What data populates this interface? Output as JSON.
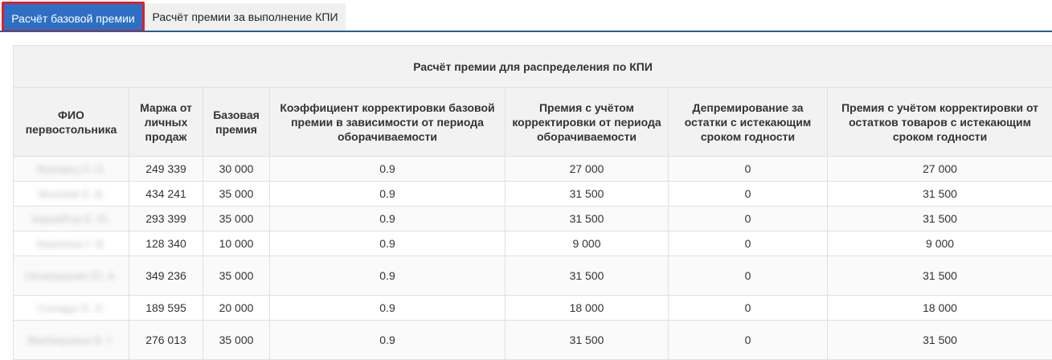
{
  "tabs": [
    {
      "label": "Расчёт базовой премии",
      "active": true
    },
    {
      "label": "Расчёт премии за выполнение КПИ",
      "active": false
    }
  ],
  "table": {
    "title": "Расчёт премии для распределения по КПИ",
    "columns": [
      "ФИО первостольника",
      "Маржа от личных продаж",
      "Базовая премия",
      "Коэффициент корректировки базовой премии в зависимости от периода оборачиваемости",
      "Премия с учётом корректировки от периода оборачиваемости",
      "Депремирование за остатки с истекающим сроком годности",
      "Премия с учётом корректировки от остатков товаров с истекающим сроком годности"
    ],
    "rows": [
      {
        "name": "Жуковец Н. Н.",
        "margin": "249 339",
        "base": "30 000",
        "coef": "0.9",
        "turnover_bonus": "27 000",
        "deduction": "0",
        "final": "27 000"
      },
      {
        "name": "Жолгаев Е. В.",
        "margin": "434 241",
        "base": "35 000",
        "coef": "0.9",
        "turnover_bonus": "31 500",
        "deduction": "0",
        "final": "31 500"
      },
      {
        "name": "Кириейтук Е. Ю.",
        "margin": "293 399",
        "base": "35 000",
        "coef": "0.9",
        "turnover_bonus": "31 500",
        "deduction": "0",
        "final": "31 500"
      },
      {
        "name": "Кирепина Г. В.",
        "margin": "128 340",
        "base": "10 000",
        "coef": "0.9",
        "turnover_bonus": "9 000",
        "deduction": "0",
        "final": "9 000"
      },
      {
        "name": "Нечипуренко Ю. А.",
        "margin": "349 236",
        "base": "35 000",
        "coef": "0.9",
        "turnover_bonus": "31 500",
        "deduction": "0",
        "final": "31 500"
      },
      {
        "name": "Солодух Е. Л.",
        "margin": "189 595",
        "base": "20 000",
        "coef": "0.9",
        "turnover_bonus": "18 000",
        "deduction": "0",
        "final": "18 000"
      },
      {
        "name": "Вербицькина В. Г.",
        "margin": "276 013",
        "base": "35 000",
        "coef": "0.9",
        "turnover_bonus": "31 500",
        "deduction": "0",
        "final": "31 500"
      }
    ]
  },
  "colors": {
    "tab_active_bg": "#2e6fc4",
    "tab_active_border": "#d9212b",
    "tab_underline": "#2b5b9f"
  }
}
